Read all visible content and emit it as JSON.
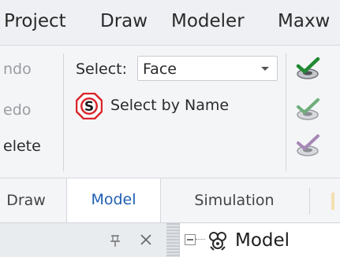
{
  "menubar": {
    "items": [
      {
        "label": "Project"
      },
      {
        "label": "Draw"
      },
      {
        "label": "Modeler"
      },
      {
        "label": "Maxw"
      }
    ]
  },
  "ribbon": {
    "edit_group": {
      "items": [
        {
          "label": "ndo",
          "enabled": false
        },
        {
          "label": "edo",
          "enabled": false
        },
        {
          "label": "elete",
          "enabled": true
        }
      ]
    },
    "select": {
      "label": "Select:",
      "value": "Face"
    },
    "select_by_name": {
      "label": "Select by Name",
      "icon_letter": "S"
    },
    "tools": [
      {
        "icon": "green-check-plane-icon",
        "color": "#1f8a32"
      },
      {
        "icon": "green-check-plane-faded-icon",
        "color": "#6fae7c"
      },
      {
        "icon": "purple-check-plane-faded-icon",
        "color": "#a787b6"
      }
    ]
  },
  "tabs": {
    "items": [
      {
        "label": "Draw"
      },
      {
        "label": "Model"
      },
      {
        "label": "Simulation"
      }
    ],
    "active": "Model"
  },
  "bottom": {
    "tree_root_label": "Model"
  },
  "colors": {
    "accent": "#1f5fb3",
    "tab_active_text": "#1f5fb3",
    "select_by_name_ring": "#d9262b"
  }
}
